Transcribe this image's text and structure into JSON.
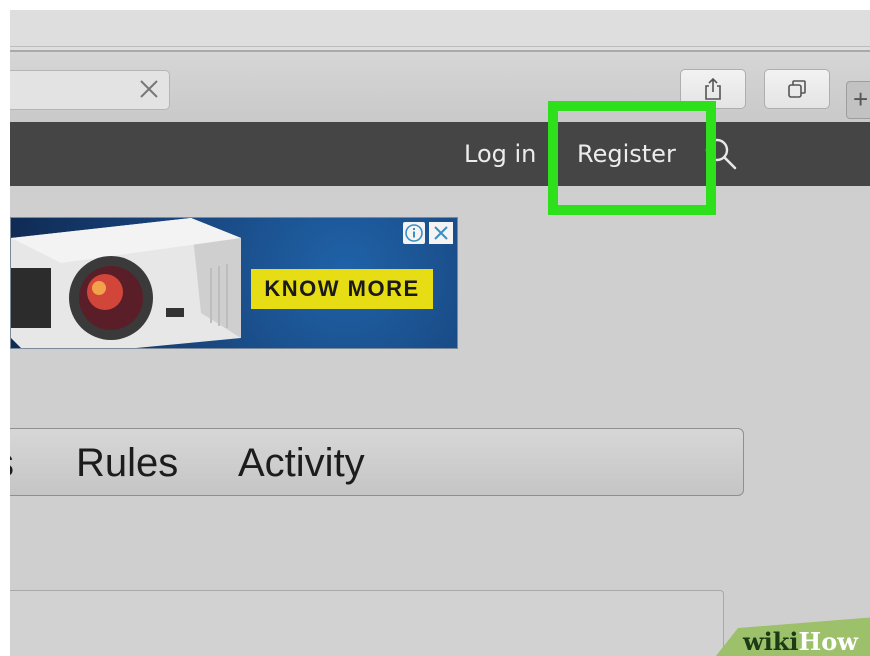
{
  "nav": {
    "login_label": "Log in",
    "register_label": "Register"
  },
  "ad": {
    "cta_label": "KNOW MORE",
    "info_glyph": "i",
    "close_glyph": "✕"
  },
  "forum_tabs": {
    "items": [
      "s",
      "Rules",
      "Activity"
    ]
  },
  "watermark": {
    "prefix": "wiki",
    "suffix": "How"
  },
  "colors": {
    "highlight": "#2ee01c",
    "navbar": "#454545",
    "ad_cta": "#e6dd14",
    "ad_bg": "#173f74"
  },
  "icons": {
    "tab_close": "close-icon",
    "share": "share-icon",
    "tabs_overview": "tabs-overview-icon",
    "new_tab": "plus-icon",
    "search": "search-icon"
  }
}
